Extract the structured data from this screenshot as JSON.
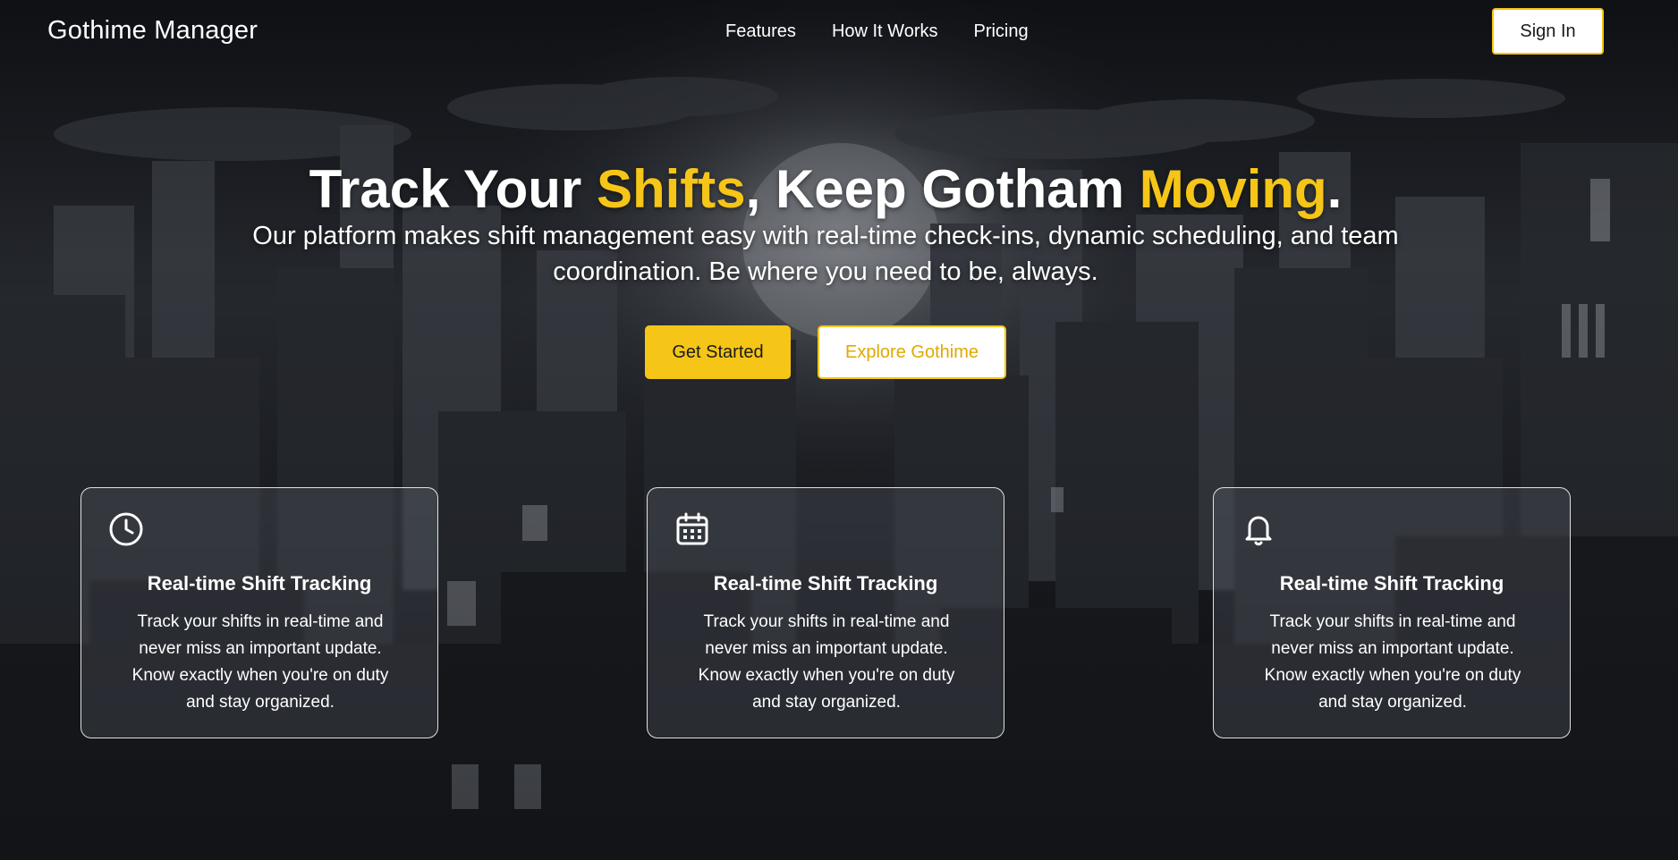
{
  "app": {
    "brand": "Gothime Manager"
  },
  "nav": {
    "links": [
      {
        "label": "Features"
      },
      {
        "label": "How It Works"
      },
      {
        "label": "Pricing"
      }
    ],
    "sign_in": "Sign In"
  },
  "hero": {
    "title_part1": "Track Your ",
    "title_accent1": "Shifts",
    "title_part2": ", Keep Gotham ",
    "title_accent2": "Moving",
    "title_part3": ".",
    "subtitle": "Our platform makes shift management easy with real-time check-ins, dynamic scheduling, and team coordination. Be where you need to be, always.",
    "primary_button": "Get Started",
    "secondary_button": "Explore Gothime"
  },
  "features": [
    {
      "icon": "clock-icon",
      "title": "Real-time Shift Tracking",
      "text": "Track your shifts in real-time and never miss an important update. Know exactly when you're on duty and stay organized."
    },
    {
      "icon": "calendar-icon",
      "title": "Real-time Shift Tracking",
      "text": "Track your shifts in real-time and never miss an important update. Know exactly when you're on duty and stay organized."
    },
    {
      "icon": "bell-icon",
      "title": "Real-time Shift Tracking",
      "text": "Track your shifts in real-time and never miss an important update. Know exactly when you're on duty and stay organized."
    }
  ],
  "colors": {
    "accent": "#f5c518",
    "text": "#ffffff",
    "background": "#0c0e12"
  }
}
